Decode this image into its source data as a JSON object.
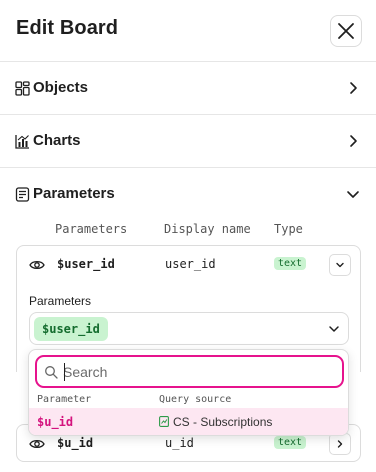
{
  "header": {
    "title": "Edit Board"
  },
  "sections": [
    {
      "label": "Objects"
    },
    {
      "label": "Charts"
    },
    {
      "label": "Parameters"
    }
  ],
  "parameters_table": {
    "columns": [
      "Parameters",
      "Display name",
      "Type"
    ],
    "rows": [
      {
        "parameter": "$user_id",
        "display_name": "user_id",
        "type": "text"
      },
      {
        "parameter": "$u_id",
        "display_name": "u_id",
        "type": "text"
      }
    ]
  },
  "editor": {
    "label": "Parameters",
    "selected_value": "$user_id"
  },
  "dropdown": {
    "search_placeholder": "Search",
    "search_value": "",
    "columns": [
      "Parameter",
      "Query source"
    ],
    "options": [
      {
        "parameter": "$u_id",
        "query_source": "CS - Subscriptions"
      }
    ]
  },
  "colors": {
    "accent": "#e6138d",
    "type_badge_bg": "#c9f3d0",
    "type_badge_text": "#146c2e",
    "option_highlight": "#fde7f2"
  }
}
